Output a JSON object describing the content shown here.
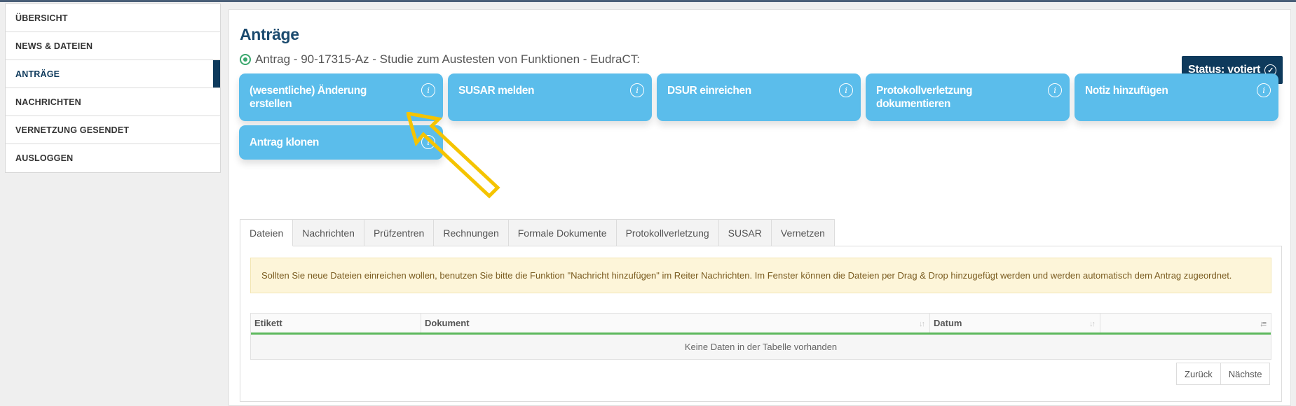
{
  "sidebar": {
    "items": [
      {
        "label": "ÜBERSICHT"
      },
      {
        "label": "NEWS & DATEIEN"
      },
      {
        "label": "ANTRÄGE"
      },
      {
        "label": "NACHRICHTEN"
      },
      {
        "label": "VERNETZUNG GESENDET"
      },
      {
        "label": "AUSLOGGEN"
      }
    ],
    "active_item": "ANTRÄGE"
  },
  "main": {
    "title": "Anträge",
    "subtitle": "Antrag - 90-17315-Az - Studie zum Austesten von Funktionen - EudraCT:",
    "status": "Status: votiert",
    "actions": [
      {
        "label": "(wesentliche) Änderung erstellen"
      },
      {
        "label": "SUSAR melden"
      },
      {
        "label": "DSUR einreichen"
      },
      {
        "label": "Protokollverletzung dokumentieren"
      },
      {
        "label": "Notiz hinzufügen"
      },
      {
        "label": "Antrag klonen"
      }
    ],
    "tabs": [
      {
        "label": "Dateien"
      },
      {
        "label": "Nachrichten"
      },
      {
        "label": "Prüfzentren"
      },
      {
        "label": "Rechnungen"
      },
      {
        "label": "Formale Dokumente"
      },
      {
        "label": "Protokollverletzung"
      },
      {
        "label": "SUSAR"
      },
      {
        "label": "Vernetzen"
      }
    ],
    "active_tab": "Dateien",
    "alert": "Sollten Sie neue Dateien einreichen wollen, benutzen Sie bitte die Funktion \"Nachricht hinzufügen\" im Reiter Nachrichten. Im Fenster können die Dateien per Drag & Drop hinzugefügt werden und werden automatisch dem Antrag zugeordnet.",
    "table": {
      "columns": [
        {
          "label": "Etikett"
        },
        {
          "label": "Dokument"
        },
        {
          "label": "Datum"
        },
        {
          "label": ""
        }
      ],
      "empty_message": "Keine Daten in der Tabelle vorhanden"
    },
    "pager": {
      "prev": "Zurück",
      "next": "Nächste"
    }
  },
  "colors": {
    "accent_dark": "#0e3a5c",
    "action_blue": "#5bbdeb",
    "highlight_arrow": "#f5c400",
    "table_accent": "#5cb85c"
  }
}
